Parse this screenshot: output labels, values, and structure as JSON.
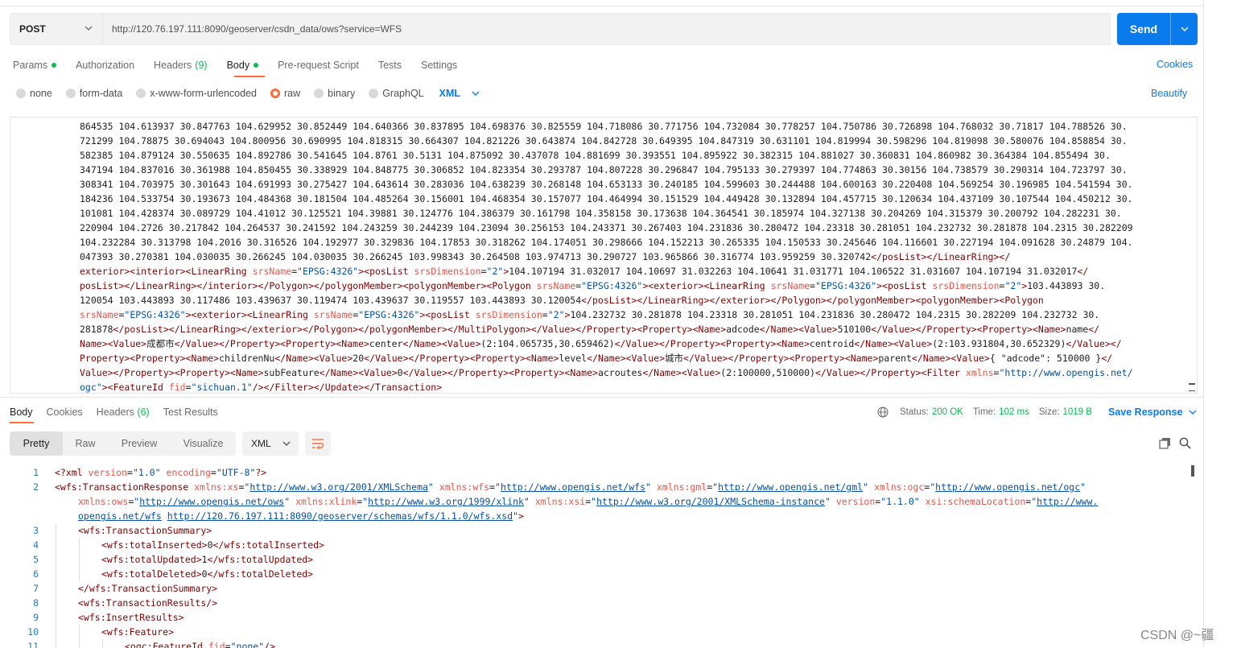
{
  "request": {
    "method": "POST",
    "url": "http://120.76.197.111:8090/geoserver/csdn_data/ows?service=WFS",
    "send_label": "Send"
  },
  "request_tabs": {
    "params": "Params",
    "authorization": "Authorization",
    "headers": "Headers",
    "headers_count": "(9)",
    "body": "Body",
    "prerequest": "Pre-request Script",
    "tests": "Tests",
    "settings": "Settings",
    "cookies": "Cookies"
  },
  "body_types": {
    "none": "none",
    "form_data": "form-data",
    "urlencoded": "x-www-form-urlencoded",
    "raw": "raw",
    "binary": "binary",
    "graphql": "GraphQL",
    "format": "XML",
    "beautify": "Beautify"
  },
  "request_body": {
    "l1": "864535 104.613937 30.847763 104.629952 30.852449 104.640366 30.837895 104.698376 30.825559 104.718086 30.771756 104.732084 30.778257 104.750786 30.726898 104.768032 30.71817 104.788526 30.",
    "l2": "721299 104.78875 30.694043 104.800956 30.690995 104.818315 30.664307 104.821226 30.643874 104.842728 30.649395 104.847319 30.631101 104.819994 30.598296 104.819098 30.580076 104.858854 30.",
    "l3": "582385 104.879124 30.550635 104.892786 30.541645 104.8761 30.5131 104.875092 30.437078 104.881699 30.393551 104.895922 30.382315 104.881027 30.360831 104.860982 30.364384 104.855494 30.",
    "l4": "347194 104.837016 30.361988 104.850455 30.338929 104.848775 30.306852 104.823354 30.293787 104.807228 30.296847 104.795133 30.279397 104.774863 30.30156 104.738579 30.290314 104.723797 30.",
    "l5": "308341 104.703975 30.301643 104.691993 30.275427 104.643614 30.283036 104.638239 30.268148 104.653133 30.240185 104.599603 30.244488 104.600163 30.220408 104.569254 30.196985 104.541594 30.",
    "l6": "184236 104.533754 30.193673 104.484368 30.181504 104.485264 30.156001 104.468354 30.157077 104.464994 30.151529 104.449428 30.132894 104.457715 30.120634 104.437109 30.107544 104.450212 30.",
    "l7": "101081 104.428374 30.089729 104.41012 30.125521 104.39881 30.124776 104.386379 30.161798 104.358158 30.173638 104.364541 30.185974 104.327138 30.204269 104.315379 30.200792 104.282231 30.",
    "l8": "220904 104.2726 30.217842 104.264537 30.241592 104.243259 30.244239 104.23094 30.256153 104.243371 30.267403 104.231836 30.280472 104.23318 30.281051 104.232732 30.281878 104.2315 30.282209",
    "l9": "104.232284 30.313798 104.2016 30.316526 104.192977 30.329836 104.17853 30.318262 104.174051 30.298666 104.152213 30.265335 104.150533 30.245646 104.116601 30.227194 104.091628 30.24879 104.",
    "l10": "047393 30.270381 104.030035 30.266245 104.030035 30.266245 103.998343 30.264508 103.974713 30.290727 103.965866 30.316774 103.959259 30.320742",
    "l11_coords": "104.107194 31.032017 104.10697 31.032263 104.10641 31.031771 104.106522 31.031607 104.107194 31.032017",
    "l13_coord": "103.443893 30.",
    "l14_coords": "120054 103.443893 30.117486 103.439637 30.119474 103.439637 30.119557 103.443893 30.120054",
    "l15_coords": "104.232732 30.281878 104.23318 30.281051 104.231836 30.280472 104.2315 30.282209 104.232732 30.",
    "l16_lead": "281878",
    "prop_adcode": "adcode",
    "val_adcode": "510100",
    "prop_name": "name",
    "val_name": "成都市",
    "prop_center": "center",
    "val_center": "(2:104.065735,30.659462)",
    "prop_centroid": "centroid",
    "val_centroid": "(2:103.931804,30.652329)",
    "prop_children": "childrenNu",
    "val_children": "20",
    "prop_level": "level",
    "val_level": "城市",
    "prop_parent": "parent",
    "val_parent": "{ \"adcode\": 510000 }",
    "prop_subfeature": "subFeature",
    "val_subfeature": "0",
    "prop_acroutes": "acroutes",
    "val_acroutes": "(2:100000,510000)",
    "ogc_url": "http://www.opengis.net/",
    "ogc_tail": "ogc",
    "fid": "sichuan.1",
    "srs": "EPSG:4326",
    "dim": "2"
  },
  "response_tabs": {
    "body": "Body",
    "cookies": "Cookies",
    "headers": "Headers",
    "headers_count": "(6)",
    "test_results": "Test Results"
  },
  "response_status": {
    "status_label": "Status:",
    "status_value": "200 OK",
    "time_label": "Time:",
    "time_value": "102 ms",
    "size_label": "Size:",
    "size_value": "1019 B",
    "save_response": "Save Response"
  },
  "response_view": {
    "pretty": "Pretty",
    "raw": "Raw",
    "preview": "Preview",
    "visualize": "Visualize",
    "format": "XML"
  },
  "response_body": {
    "line_numbers": [
      "1",
      "2",
      "3",
      "4",
      "5",
      "6",
      "7",
      "8",
      "9",
      "10",
      "11"
    ],
    "xml_version": "1.0",
    "xml_encoding": "UTF-8",
    "ns_xs": "http://www.w3.org/2001/XMLSchema",
    "ns_wfs": "http://www.opengis.net/wfs",
    "ns_gml": "http://www.opengis.net/gml",
    "ns_ogc": "http://www.opengis.net/ogc",
    "ns_ows": "http://www.opengis.net/ows",
    "ns_xlink": "http://www.w3.org/1999/xlink",
    "ns_xsi": "http://www.w3.org/2001/XMLSchema-instance",
    "wfs_version": "1.1.0",
    "schema_loc_a": "http://www.",
    "schema_loc_b": "opengis.net/wfs",
    "schema_loc_c": "http://120.76.197.111:8090/geoserver/schemas/wfs/1.1.0/wfs.xsd",
    "total_inserted": "0",
    "total_updated": "1",
    "total_deleted": "0",
    "feature_fid": "none"
  },
  "watermark": "CSDN @~疆"
}
